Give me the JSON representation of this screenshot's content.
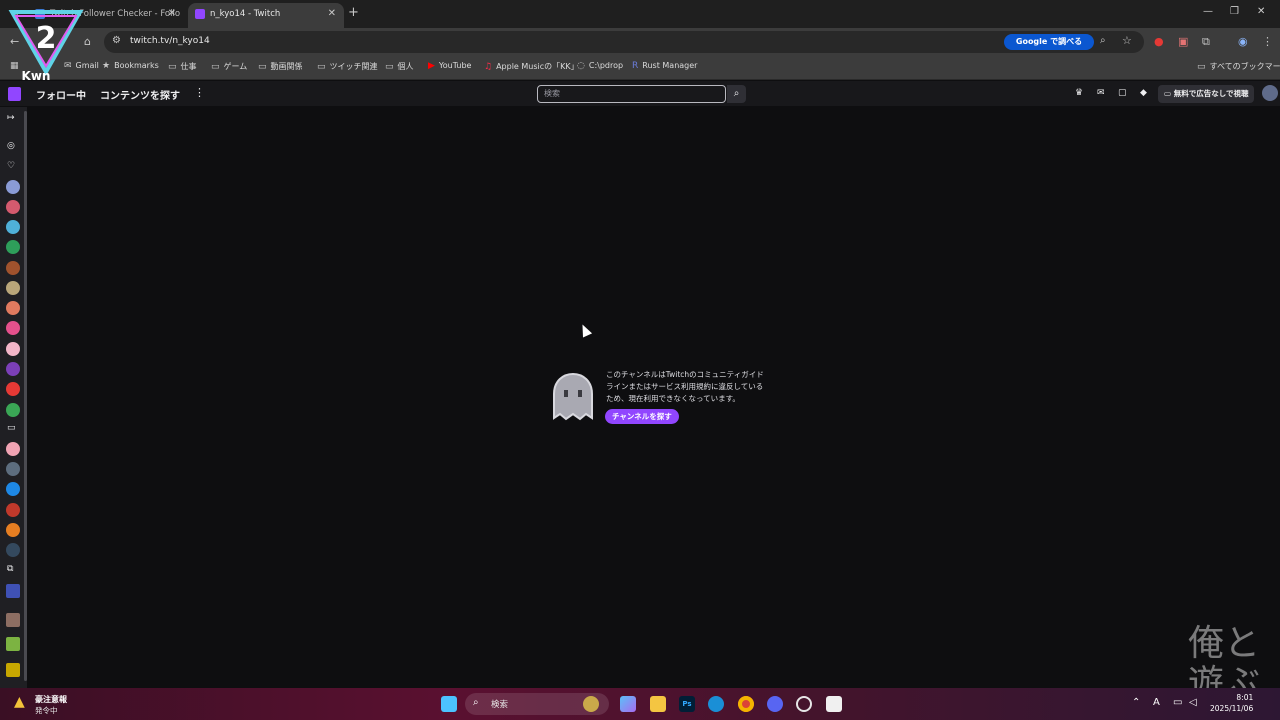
{
  "browser": {
    "tabs": [
      {
        "label": "Twitch Follower Checker - Follo",
        "active": false
      },
      {
        "label": "n_kyo14 - Twitch",
        "active": true
      }
    ],
    "new_tab_icon": "plus-icon",
    "url": "twitch.tv/n_kyo14",
    "google_button": "Google で調べる",
    "bookmarks": [
      {
        "label": "Gmail",
        "icon": "mail-icon"
      },
      {
        "label": "Bookmarks",
        "icon": "star-icon"
      },
      {
        "label": "仕事",
        "icon": "folder-icon"
      },
      {
        "label": "ゲーム",
        "icon": "folder-icon"
      },
      {
        "label": "動画関係",
        "icon": "folder-icon"
      },
      {
        "label": "ツイッチ関連",
        "icon": "folder-icon"
      },
      {
        "label": "個人",
        "icon": "folder-icon"
      },
      {
        "label": "YouTube",
        "icon": "youtube-icon"
      },
      {
        "label": "Apple Musicの「KK」",
        "icon": "apple-music-icon"
      },
      {
        "label": "C:\\pdrop",
        "icon": "dropper-icon"
      },
      {
        "label": "Rust Manager",
        "icon": "rust-icon"
      }
    ],
    "all_bookmarks": "すべてのブックマーク"
  },
  "twitch": {
    "nav": {
      "following": "フォロー中",
      "browse": "コンテンツを探す",
      "search_placeholder": "検索",
      "adfree": "無料で広告なしで視聴"
    },
    "channel": {
      "message": "このチャンネルはTwitchのコミュニティガイドラインまたはサービス利用規約に違反しているため、現在利用できなくなっています。",
      "button": "チャンネルを探す"
    }
  },
  "taskbar": {
    "weather_title": "豪注意報",
    "weather_sub": "発令中",
    "search_label": "検索",
    "clock_time": "8:01",
    "clock_date": "2025/11/06"
  },
  "watermark": {
    "corner_text": "俺と遊ぶ"
  },
  "colors": {
    "twitch_purple": "#9146ff",
    "page_bg": "#0e0e10",
    "google_blue": "#0b57d0"
  }
}
